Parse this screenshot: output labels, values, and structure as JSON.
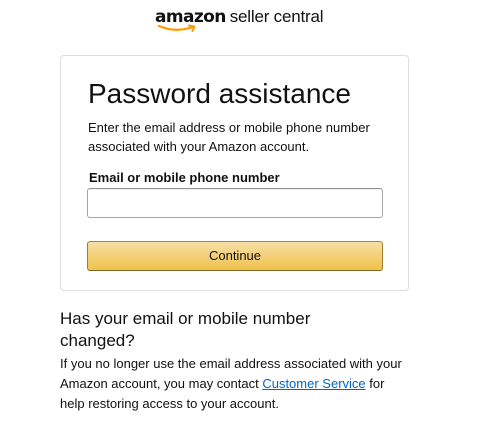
{
  "header": {
    "logo_amazon": "amazon",
    "logo_rest": "seller central"
  },
  "card": {
    "title": "Password assistance",
    "description": "Enter the email address or mobile phone number associated with your Amazon account.",
    "field_label": "Email or mobile phone number",
    "email_value": "",
    "continue_label": "Continue"
  },
  "changed": {
    "title": "Has your email or mobile number changed?",
    "text_before": "If you no longer use the email address associated with your Amazon account, you may contact ",
    "link_text": "Customer Service",
    "text_after": " for help restoring access to your account."
  },
  "colors": {
    "button_top": "#f7dfa5",
    "button_bottom": "#f0c14b",
    "link": "#0066c0",
    "smile": "#ff9900"
  },
  "icons": {
    "logo_smile": "amazon-smile-arrow"
  }
}
